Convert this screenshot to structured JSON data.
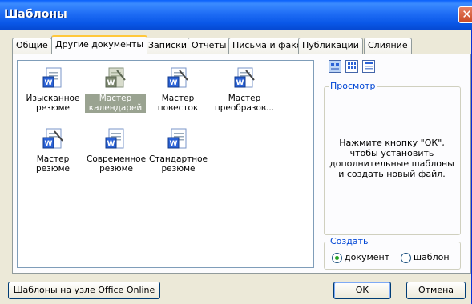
{
  "window": {
    "title": "Шаблоны"
  },
  "tabs": [
    {
      "label": "Общие",
      "active": false
    },
    {
      "label": "Другие документы",
      "active": true
    },
    {
      "label": "Записки",
      "active": false
    },
    {
      "label": "Отчеты",
      "active": false
    },
    {
      "label": "Письма и факсы",
      "active": false
    },
    {
      "label": "Публикации",
      "active": false
    },
    {
      "label": "Слияние",
      "active": false
    }
  ],
  "templates": [
    {
      "label": "Изысканное резюме",
      "icon": "word-document-icon",
      "selected": false
    },
    {
      "label": "Мастер календарей",
      "icon": "word-wizard-icon",
      "selected": true
    },
    {
      "label": "Мастер повесток",
      "icon": "word-wizard-icon",
      "selected": false
    },
    {
      "label": "Мастер преобразов...",
      "icon": "word-wizard-icon",
      "selected": false
    },
    {
      "label": "Мастер резюме",
      "icon": "word-wizard-icon",
      "selected": false
    },
    {
      "label": "Современное резюме",
      "icon": "word-document-icon",
      "selected": false
    },
    {
      "label": "Стандартное резюме",
      "icon": "word-document-icon",
      "selected": false
    }
  ],
  "view_buttons": [
    "large-icons-view-icon",
    "list-view-icon",
    "details-view-icon"
  ],
  "preview": {
    "label": "Просмотр",
    "text": "Нажмите кнопку \"ОК\", чтобы установить дополнительные шаблоны и создать новый файл."
  },
  "create": {
    "label": "Создать",
    "options": [
      {
        "label": "документ",
        "checked": true
      },
      {
        "label": "шаблон",
        "checked": false
      }
    ]
  },
  "buttons": {
    "online": "Шаблоны на узле Office Online",
    "ok": "ОК",
    "cancel": "Отмена"
  },
  "colors": {
    "titlebar": "#0a58e8",
    "dialog_bg": "#ece9d8",
    "selection": "#9aa391",
    "group_label": "#0046d5"
  }
}
